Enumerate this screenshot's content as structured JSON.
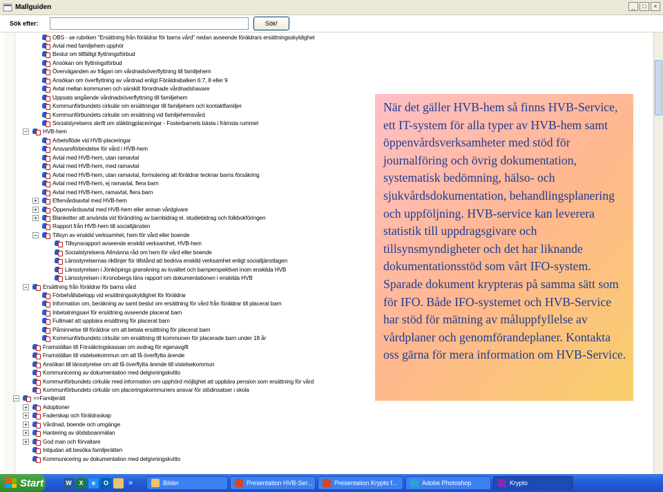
{
  "window": {
    "title": "Mallguiden"
  },
  "search": {
    "label": "Sök efter:",
    "value": "",
    "button_label": "Sök!"
  },
  "tree": {
    "rows": [
      {
        "text": "OBS - se rubriken \"Ersättning från föräldrar för barns vård\" nedan avseende föräldrars ersättningsskyldighet",
        "level": 3,
        "type": "doc"
      },
      {
        "text": "Avtal med familjehem upphör",
        "level": 3,
        "type": "doc"
      },
      {
        "text": "Beslut om tillfälligt flyttningsförbud",
        "level": 3,
        "type": "doc"
      },
      {
        "text": "Ansökan om flyttningsförbud",
        "level": 3,
        "type": "doc"
      },
      {
        "text": "Överväganden av frågan om vårdnadsöverflyttning till familjehem",
        "level": 3,
        "type": "doc"
      },
      {
        "text": "Ansökan om överflyttning av vårdnad enligt Föräldrabalken 6:7, 8 eller 9",
        "level": 3,
        "type": "doc"
      },
      {
        "text": "Avtal mellan kommunen och särskilt förordnade vårdnadshavare",
        "level": 3,
        "type": "doc"
      },
      {
        "text": "Uppsats angående vårdnadsöverflyttning till familjehem",
        "level": 3,
        "type": "doc"
      },
      {
        "text": "Kommunförbundets cirkulär om ersättningar till familjehem och kontaktfamiljer",
        "level": 3,
        "type": "doc"
      },
      {
        "text": "Kommunförbundets cirkulär om ersättning vid familjehemsvård",
        "level": 3,
        "type": "doc"
      },
      {
        "text": "Socialstyrelsens skrift om släktingplaceringar - Fosterbarnets bästa i främsta rummet",
        "level": 3,
        "type": "doc"
      },
      {
        "text": "HVB-hem",
        "level": 2,
        "type": "folder",
        "exp": "-"
      },
      {
        "text": "Arbetsflöde vid HVB-placeringar",
        "level": 3,
        "type": "doc"
      },
      {
        "text": "Ansvarsförbindelse för vård i HVB-hem",
        "level": 3,
        "type": "doc"
      },
      {
        "text": "Avtal med HVB-hem, utan ramavtal",
        "level": 3,
        "type": "doc"
      },
      {
        "text": "Avtal med HVB-hem, med ramavtal",
        "level": 3,
        "type": "doc"
      },
      {
        "text": "Avtal med HVB-hem, utan ramavtal, formulering att föräldrar tecknar barns försäkring",
        "level": 3,
        "type": "doc"
      },
      {
        "text": "Avtal med HVB-hem, ej ramavtal, flera barn",
        "level": 3,
        "type": "doc"
      },
      {
        "text": "Avtal med HVB-hem, ramavtal, flera barn",
        "level": 3,
        "type": "doc"
      },
      {
        "text": "Eftervårdsavtal med HVB-hem",
        "level": 3,
        "type": "folder",
        "exp": "+"
      },
      {
        "text": "Öppenvårdsavtal med HVB-hem eller annan vårdgivare",
        "level": 3,
        "type": "folder",
        "exp": "+"
      },
      {
        "text": "Blanketter att använda vid förändring av barnbidrag el. studiebidrag och folkbokföringen",
        "level": 3,
        "type": "folder",
        "exp": "+"
      },
      {
        "text": "Rapport från HVB-hem till socialtjänsten",
        "level": 3,
        "type": "doc"
      },
      {
        "text": "Tillsyn av enskild verksamhet, hem för vård eller boende",
        "level": 3,
        "type": "folder",
        "exp": "-"
      },
      {
        "text": "Tillsynsrapport avseende enskild verksamhet, HVB-hem",
        "level": 4,
        "type": "doc"
      },
      {
        "text": "Socialstyrelsens Allmänna råd om hem för vård eller boende",
        "level": 4,
        "type": "doc"
      },
      {
        "text": "Länsstyrelsernas riktlinjer för tillstånd att bedriva enskild verksamhet enligt socialtjänstlagen",
        "level": 4,
        "type": "doc"
      },
      {
        "text": "Länsstyrelsen i Jönköpings granskning av kvalitet och barnperspektivet inom enskilda HVB",
        "level": 4,
        "type": "doc"
      },
      {
        "text": "Länsstyrelsen i Kronobergs läns rapport om dokumentationen i enskilda HVB",
        "level": 4,
        "type": "doc"
      },
      {
        "text": "Ersättning från föräldrar för barns vård",
        "level": 2,
        "type": "folder",
        "exp": "-"
      },
      {
        "text": "Förbehållsbelopp vid ersättningsskyldighet för föräldrar",
        "level": 3,
        "type": "doc"
      },
      {
        "text": "Information om, beräkning av samt beslut om ersättning för vård från föräldrar till placerat barn",
        "level": 3,
        "type": "doc"
      },
      {
        "text": "Inbetalningsavi för ersättning avseende placerat barn",
        "level": 3,
        "type": "doc"
      },
      {
        "text": "Fullmakt att uppbära ersättning för placerat barn",
        "level": 3,
        "type": "doc"
      },
      {
        "text": "Påminnelse till föräldrar om att betala ersättning för placerat barn",
        "level": 3,
        "type": "doc"
      },
      {
        "text": "Kommunförbundets cirkulär om ersättning till kommunen för placerade barn under 18 år",
        "level": 3,
        "type": "doc"
      },
      {
        "text": "Framställan till Försäkringskassan om avdrag för egenavgift",
        "level": 2,
        "type": "doc"
      },
      {
        "text": "Framställan till vistelsekommun om att få överflytta ärende",
        "level": 2,
        "type": "doc"
      },
      {
        "text": "Ansökan till länsstyrelse om att få överflytta ärende till vistelsekommun",
        "level": 2,
        "type": "doc"
      },
      {
        "text": "Kommunicering av dokumentation med delgivningskvitto",
        "level": 2,
        "type": "doc"
      },
      {
        "text": "Kommunförbundets cirkulär med information om upphörd möjlighet att uppbära pension som ersättning för vård",
        "level": 2,
        "type": "doc"
      },
      {
        "text": "Kommunförbundets cirkulär om placeringskommuners ansvar för stödinsatser i skola",
        "level": 2,
        "type": "doc"
      },
      {
        "text": ">>Familjerätt",
        "level": 1,
        "type": "folder",
        "exp": "-"
      },
      {
        "text": "Adoptioner",
        "level": 2,
        "type": "folder",
        "exp": "+"
      },
      {
        "text": "Faderskap och föräldraskap",
        "level": 2,
        "type": "folder",
        "exp": "+"
      },
      {
        "text": "Vårdnad, boende och umgänge",
        "level": 2,
        "type": "folder",
        "exp": "+"
      },
      {
        "text": "Hantering av dödsboanmälan",
        "level": 2,
        "type": "folder",
        "exp": "+"
      },
      {
        "text": "God man och förvaltare",
        "level": 2,
        "type": "folder",
        "exp": "+"
      },
      {
        "text": "Inbjudan att besöka familjerätten",
        "level": 2,
        "type": "doc"
      },
      {
        "text": "Kommunicering av dokumentation med delgivningskvitto",
        "level": 2,
        "type": "doc"
      }
    ]
  },
  "infobox": {
    "text": "När det gäller HVB-hem så finns HVB-Service, ett IT-system för alla typer av HVB-hem samt öppenvårdsverksamheter med stöd för journalföring och övrig dokumentation, systematisk bedömning, hälso- och sjukvårdsdokumentation, behandlingsplanering och uppföljning. HVB-service kan leverera statistik till uppdragsgivare och tillsynsmyndigheter och det har liknande dokumentationsstöd som vårt IFO-system. Sparade dokument krypteras på samma sätt som för IFO. Både IFO-systemet och HVB-Service har stöd för mätning av måluppfyllelse av vårdplaner och genomförandeplaner. Kontakta oss gärna för mera information om HVB-Service."
  },
  "taskbar": {
    "start_label": "Start",
    "more": "»",
    "quick_icons": [
      {
        "name": "word-icon",
        "glyph": "W",
        "color": "#2b579a"
      },
      {
        "name": "excel-icon",
        "glyph": "X",
        "color": "#1d7a3c"
      },
      {
        "name": "ie-icon",
        "glyph": "e",
        "color": "#1e90ff"
      },
      {
        "name": "outlook-icon",
        "glyph": "O",
        "color": "#0063b1"
      },
      {
        "name": "folder-icon",
        "glyph": "",
        "color": "#e9c46a"
      }
    ],
    "tasks": [
      {
        "label": "Bilder",
        "icon_color": "#e9c46a",
        "active": false
      },
      {
        "label": "Presentation HVB-Ser...",
        "icon_color": "#d24726",
        "active": false
      },
      {
        "label": "Presentation Krypto f...",
        "icon_color": "#d24726",
        "active": false
      },
      {
        "label": "Adobe Photoshop",
        "icon_color": "#2da0d8",
        "active": false
      },
      {
        "label": "Krypto",
        "icon_color": "#7a2fb5",
        "active": true
      }
    ]
  },
  "colors": {
    "infobox_text": "#1f3c90",
    "taskbar": "#245edb",
    "start": "#3a9a37"
  }
}
